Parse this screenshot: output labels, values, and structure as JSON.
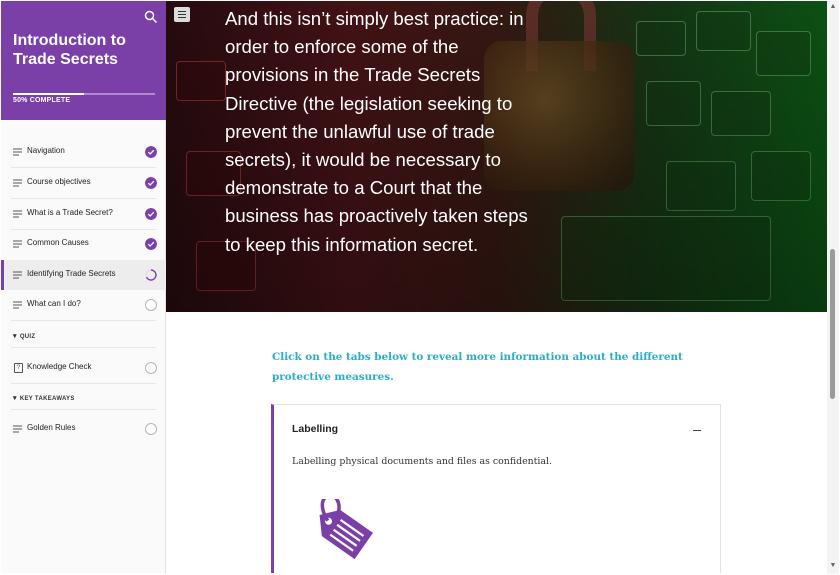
{
  "sidebar": {
    "course_title": "Introduction to Trade Secrets",
    "progress_label": "50% COMPLETE",
    "progress_fraction": 0.5,
    "items": [
      {
        "label": "Navigation",
        "status": "done"
      },
      {
        "label": "Course objectives",
        "status": "done"
      },
      {
        "label": "What is a Trade Secret?",
        "status": "done"
      },
      {
        "label": "Common Causes",
        "status": "done"
      },
      {
        "label": "Identifying Trade Secrets",
        "status": "in-progress"
      },
      {
        "label": "What can I do?",
        "status": "not-started"
      }
    ],
    "sections": [
      {
        "label": "QUIZ",
        "items": [
          {
            "label": "Knowledge Check",
            "status": "not-started"
          }
        ]
      },
      {
        "label": "KEY TAKEAWAYS",
        "items": [
          {
            "label": "Golden Rules",
            "status": "not-started"
          }
        ]
      }
    ]
  },
  "main": {
    "hero_text": "And this isn’t simply best practice: in order to enforce some of the provisions in the Trade Secrets Directive (the legislation seeking to prevent the unlawful use of trade secrets), it would be necessary to demonstrate to a Court that the business has proactively taken steps to keep this information secret.",
    "instruction": "Click on the tabs below to reveal more information about the different protective measures.",
    "tab": {
      "title": "Labelling",
      "body": "Labelling physical documents and files as confidential.",
      "icon": "tag-icon"
    }
  },
  "colors": {
    "accent": "#7b3fa8",
    "instruction": "#29aec8"
  }
}
